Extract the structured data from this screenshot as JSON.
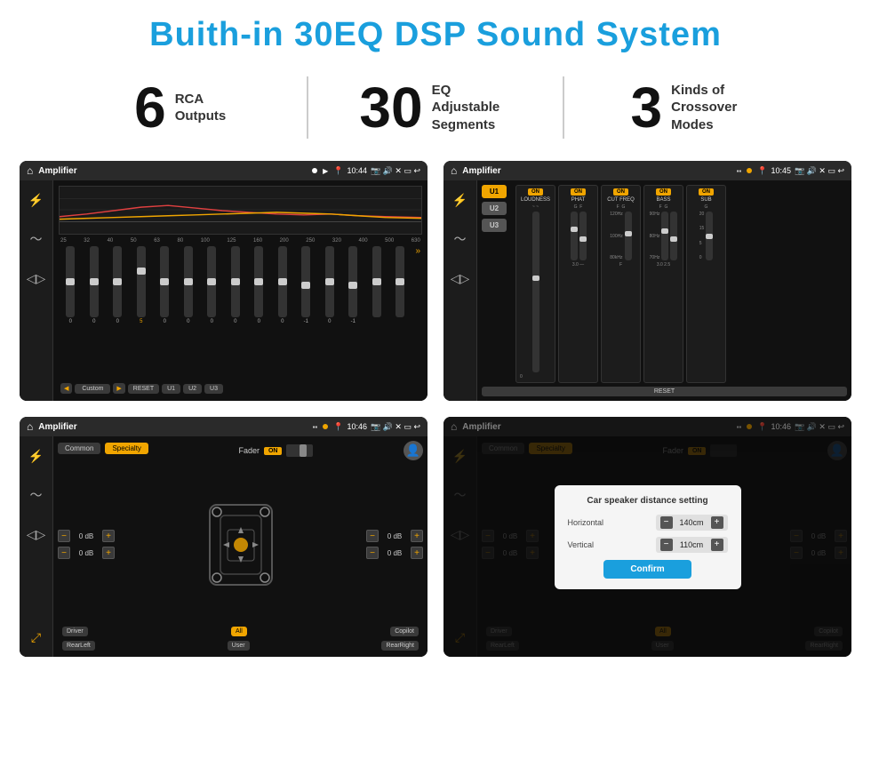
{
  "page": {
    "title": "Buith-in 30EQ DSP Sound System",
    "stats": [
      {
        "number": "6",
        "label": "RCA\nOutputs"
      },
      {
        "number": "30",
        "label": "EQ Adjustable\nSegments"
      },
      {
        "number": "3",
        "label": "Kinds of\nCrossover Modes"
      }
    ],
    "screens": [
      {
        "id": "eq-screen",
        "status_bar": {
          "app_name": "Amplifier",
          "time": "10:44"
        },
        "type": "eq"
      },
      {
        "id": "crossover-screen",
        "status_bar": {
          "app_name": "Amplifier",
          "time": "10:45"
        },
        "type": "crossover"
      },
      {
        "id": "fader-screen",
        "status_bar": {
          "app_name": "Amplifier",
          "time": "10:46"
        },
        "type": "fader"
      },
      {
        "id": "distance-screen",
        "status_bar": {
          "app_name": "Amplifier",
          "time": "10:46"
        },
        "type": "distance_dialog"
      }
    ],
    "eq": {
      "frequencies": [
        "25",
        "32",
        "40",
        "50",
        "63",
        "80",
        "100",
        "125",
        "160",
        "200",
        "250",
        "320",
        "400",
        "500",
        "630"
      ],
      "values": [
        "0",
        "0",
        "0",
        "5",
        "0",
        "0",
        "0",
        "0",
        "0",
        "0",
        "-1",
        "0",
        "-1",
        "",
        ""
      ],
      "preset_label": "Custom",
      "buttons": [
        "RESET",
        "U1",
        "U2",
        "U3"
      ]
    },
    "crossover": {
      "presets": [
        "U1",
        "U2",
        "U3"
      ],
      "channels": [
        "LOUDNESS",
        "PHAT",
        "CUT FREQ",
        "BASS",
        "SUB"
      ],
      "on_labels": [
        "ON",
        "ON",
        "ON",
        "ON",
        "ON"
      ],
      "reset_label": "RESET"
    },
    "fader": {
      "tabs": [
        "Common",
        "Specialty"
      ],
      "fader_label": "Fader",
      "on_label": "ON",
      "volumes": [
        "0 dB",
        "0 dB",
        "0 dB",
        "0 dB"
      ],
      "bottom_buttons": [
        "Driver",
        "Copilot",
        "RearLeft",
        "All",
        "User",
        "RearRight"
      ]
    },
    "dialog": {
      "title": "Car speaker distance setting",
      "horizontal_label": "Horizontal",
      "horizontal_value": "140cm",
      "vertical_label": "Vertical",
      "vertical_value": "110cm",
      "confirm_label": "Confirm"
    }
  }
}
